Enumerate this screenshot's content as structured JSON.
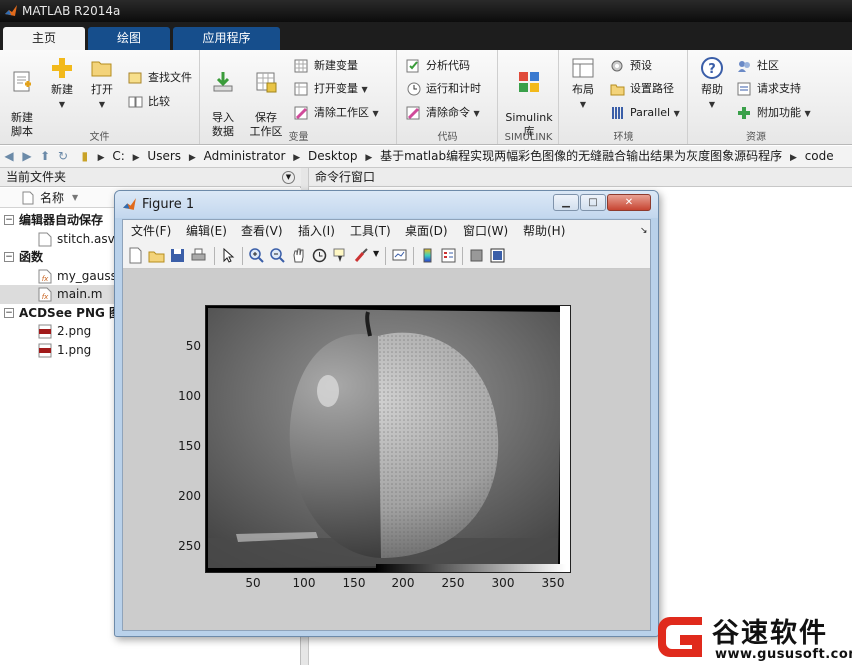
{
  "app": {
    "title": "MATLAB R2014a"
  },
  "tabs": [
    {
      "label": "主页",
      "active": true
    },
    {
      "label": "绘图",
      "active": false
    },
    {
      "label": "应用程序",
      "active": false
    }
  ],
  "ribbon": {
    "file_group": {
      "label": "文件",
      "new_script": "新建\n脚本",
      "new": "新建",
      "open": "打开",
      "find_files": "查找文件",
      "compare": "比较"
    },
    "variable_group": {
      "label": "变量",
      "import_data": "导入\n数据",
      "save_workspace": "保存\n工作区",
      "new_variable": "新建变量",
      "open_variable": "打开变量",
      "clear_workspace": "清除工作区"
    },
    "code_group": {
      "label": "代码",
      "analyze_code": "分析代码",
      "run_and_time": "运行和计时",
      "clear_commands": "清除命令"
    },
    "simulink_group": {
      "label": "SIMULINK",
      "simulink_library": "Simulink\n库"
    },
    "environment_group": {
      "label": "环境",
      "layout": "布局",
      "preferences": "预设",
      "set_path": "设置路径",
      "parallel": "Parallel"
    },
    "resources_group": {
      "label": "资源",
      "help": "帮助",
      "community": "社区",
      "request_support": "请求支持",
      "add_ons": "附加功能"
    }
  },
  "address_bar": {
    "crumbs": [
      "C:",
      "Users",
      "Administrator",
      "Desktop",
      "基于matlab编程实现两幅彩色图像的无缝融合输出结果为灰度图象源码程序",
      "code"
    ]
  },
  "current_folder": {
    "title": "当前文件夹",
    "column_name": "名称",
    "groups": [
      {
        "name": "编辑器自动保存",
        "files": [
          "stitch.asv"
        ]
      },
      {
        "name": "函数",
        "files": [
          "my_gauss",
          "main.m"
        ]
      },
      {
        "name": "ACDSee PNG 图",
        "files": [
          "2.png",
          "1.png"
        ]
      }
    ],
    "selected_file": "main.m"
  },
  "command_window": {
    "title": "命令行窗口"
  },
  "figure": {
    "title": "Figure 1",
    "menu": [
      "文件(F)",
      "编辑(E)",
      "查看(V)",
      "插入(I)",
      "工具(T)",
      "桌面(D)",
      "窗口(W)",
      "帮助(H)"
    ],
    "axes": {
      "y_ticks": [
        "50",
        "100",
        "150",
        "200",
        "250"
      ],
      "x_ticks": [
        "50",
        "100",
        "150",
        "200",
        "250",
        "300",
        "350"
      ]
    },
    "image_icon": "grayscale-fused-apple-orange"
  },
  "watermark": {
    "text": "谷速软件",
    "url": "www.gususoft.com"
  }
}
